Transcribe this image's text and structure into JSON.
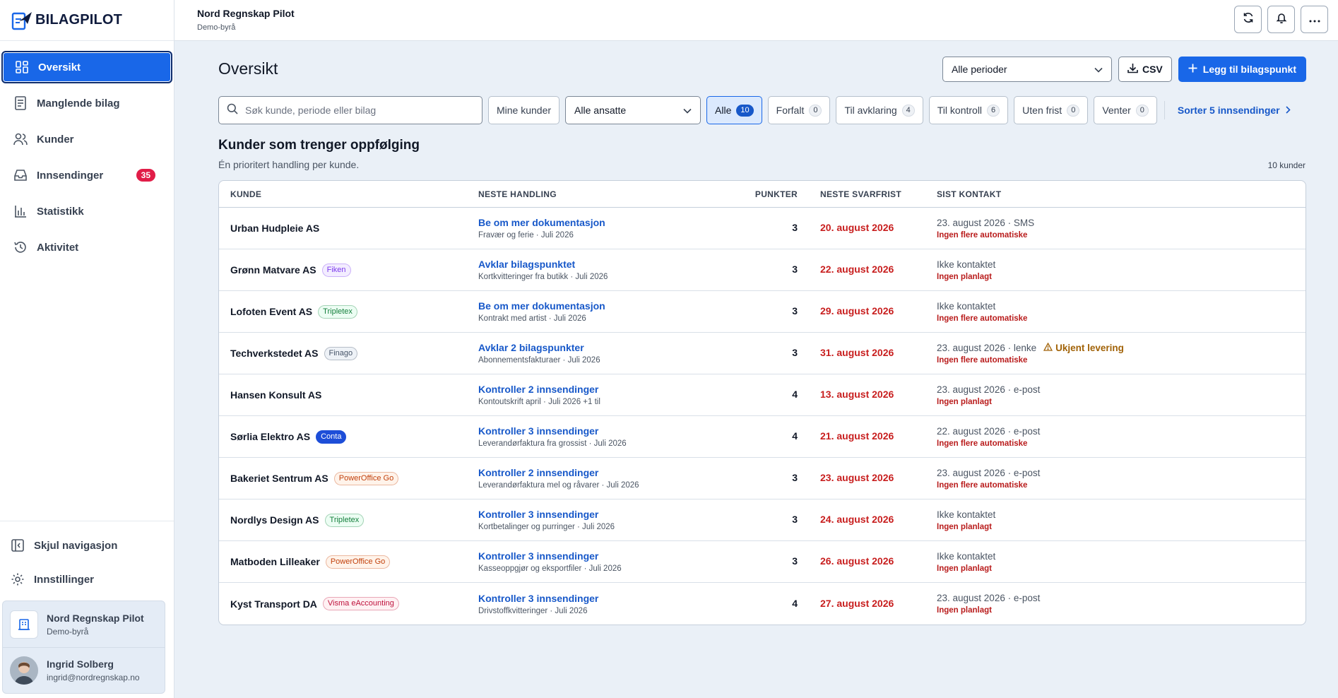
{
  "app": {
    "brand": "BILAGPILOT"
  },
  "topbar": {
    "org_name": "Nord Regnskap Pilot",
    "org_sub": "Demo-byrå"
  },
  "nav": {
    "items": [
      {
        "label": "Oversikt",
        "icon": "dashboard-icon",
        "active": true
      },
      {
        "label": "Manglende bilag",
        "icon": "document-icon"
      },
      {
        "label": "Kunder",
        "icon": "users-icon"
      },
      {
        "label": "Innsendinger",
        "icon": "inbox-icon",
        "badge": "35"
      },
      {
        "label": "Statistikk",
        "icon": "chart-icon"
      },
      {
        "label": "Aktivitet",
        "icon": "history-icon"
      }
    ],
    "hide_nav": "Skjul navigasjon",
    "settings": "Innstillinger",
    "org": {
      "name": "Nord Regnskap Pilot",
      "sub": "Demo-byrå"
    },
    "user": {
      "name": "Ingrid Solberg",
      "email": "ingrid@nordregnskap.no"
    }
  },
  "page": {
    "title": "Oversikt",
    "period_select": "Alle perioder",
    "csv_label": "CSV",
    "add_label": "Legg til bilagspunkt",
    "search_placeholder": "Søk kunde, periode eller bilag",
    "mine_label": "Mine kunder",
    "employees_select": "Alle ansatte",
    "filters": [
      {
        "label": "Alle",
        "count": "10",
        "selected": true
      },
      {
        "label": "Forfalt",
        "count": "0"
      },
      {
        "label": "Til avklaring",
        "count": "4"
      },
      {
        "label": "Til kontroll",
        "count": "6"
      },
      {
        "label": "Uten frist",
        "count": "0"
      },
      {
        "label": "Venter",
        "count": "0"
      }
    ],
    "sort_link": "Sorter 5 innsendinger",
    "section_title": "Kunder som trenger oppfølging",
    "section_sub": "Én prioritert handling per kunde.",
    "count_label": "10 kunder"
  },
  "table": {
    "headers": {
      "kunde": "KUNDE",
      "handling": "NESTE HANDLING",
      "punkter": "PUNKTER",
      "frist": "NESTE SVARFRIST",
      "kontakt": "SIST KONTAKT"
    },
    "rows": [
      {
        "customer": "Urban Hudpleie AS",
        "tag": "",
        "action": "Be om mer dokumentasjon",
        "action_sub": "Fravær og ferie · Juli 2026",
        "points": "3",
        "due": "20. august 2026",
        "last": "23. august 2026 · SMS",
        "warn": "",
        "last_sub": "Ingen flere automatiske"
      },
      {
        "customer": "Grønn Matvare AS",
        "tag": "Fiken",
        "tag_color": "#7c3aed",
        "tag_bg": "#f3edff",
        "action": "Avklar bilagspunktet",
        "action_sub": "Kortkvitteringer fra butikk · Juli 2026",
        "points": "3",
        "due": "22. august 2026",
        "last": "Ikke kontaktet",
        "warn": "",
        "last_sub": "Ingen planlagt"
      },
      {
        "customer": "Lofoten Event AS",
        "tag": "Tripletex",
        "tag_color": "#15803d",
        "tag_bg": "#ecfdf3",
        "action": "Be om mer dokumentasjon",
        "action_sub": "Kontrakt med artist · Juli 2026",
        "points": "3",
        "due": "29. august 2026",
        "last": "Ikke kontaktet",
        "warn": "",
        "last_sub": "Ingen flere automatiske"
      },
      {
        "customer": "Techverkstedet AS",
        "tag": "Finago",
        "tag_color": "#475569",
        "tag_bg": "#eef2f7",
        "action": "Avklar 2 bilagspunkter",
        "action_sub": "Abonnementsfakturaer · Juli 2026",
        "points": "3",
        "due": "31. august 2026",
        "last": "23. august 2026 · lenke",
        "warn": "Ukjent levering",
        "last_sub": "Ingen flere automatiske"
      },
      {
        "customer": "Hansen Konsult AS",
        "tag": "",
        "action": "Kontroller 2 innsendinger",
        "action_sub": "Kontoutskrift april · Juli 2026 +1 til",
        "points": "4",
        "due": "13. august 2026",
        "last": "23. august 2026 · e-post",
        "warn": "",
        "last_sub": "Ingen planlagt"
      },
      {
        "customer": "Sørlia Elektro AS",
        "tag": "Conta",
        "tag_color": "#ffffff",
        "tag_bg": "#1d4ed8",
        "action": "Kontroller 3 innsendinger",
        "action_sub": "Leverandørfaktura fra grossist · Juli 2026",
        "points": "4",
        "due": "21. august 2026",
        "last": "22. august 2026 · e-post",
        "warn": "",
        "last_sub": "Ingen flere automatiske"
      },
      {
        "customer": "Bakeriet Sentrum AS",
        "tag": "PowerOffice Go",
        "tag_color": "#c2410c",
        "tag_bg": "#fff3ea",
        "action": "Kontroller 2 innsendinger",
        "action_sub": "Leverandørfaktura mel og råvarer · Juli 2026",
        "points": "3",
        "due": "23. august 2026",
        "last": "23. august 2026 · e-post",
        "warn": "",
        "last_sub": "Ingen flere automatiske"
      },
      {
        "customer": "Nordlys Design AS",
        "tag": "Tripletex",
        "tag_color": "#15803d",
        "tag_bg": "#ecfdf3",
        "action": "Kontroller 3 innsendinger",
        "action_sub": "Kortbetalinger og purringer · Juli 2026",
        "points": "3",
        "due": "24. august 2026",
        "last": "Ikke kontaktet",
        "warn": "",
        "last_sub": "Ingen planlagt"
      },
      {
        "customer": "Matboden Lilleaker",
        "tag": "PowerOffice Go",
        "tag_color": "#c2410c",
        "tag_bg": "#fff3ea",
        "action": "Kontroller 3 innsendinger",
        "action_sub": "Kasseoppgjør og eksportfiler · Juli 2026",
        "points": "3",
        "due": "26. august 2026",
        "last": "Ikke kontaktet",
        "warn": "",
        "last_sub": "Ingen planlagt"
      },
      {
        "customer": "Kyst Transport DA",
        "tag": "Visma eAccounting",
        "tag_color": "#be123c",
        "tag_bg": "#fff1f3",
        "action": "Kontroller 3 innsendinger",
        "action_sub": "Drivstoffkvitteringer · Juli 2026",
        "points": "4",
        "due": "27. august 2026",
        "last": "23. august 2026 · e-post",
        "warn": "",
        "last_sub": "Ingen planlagt"
      }
    ]
  }
}
